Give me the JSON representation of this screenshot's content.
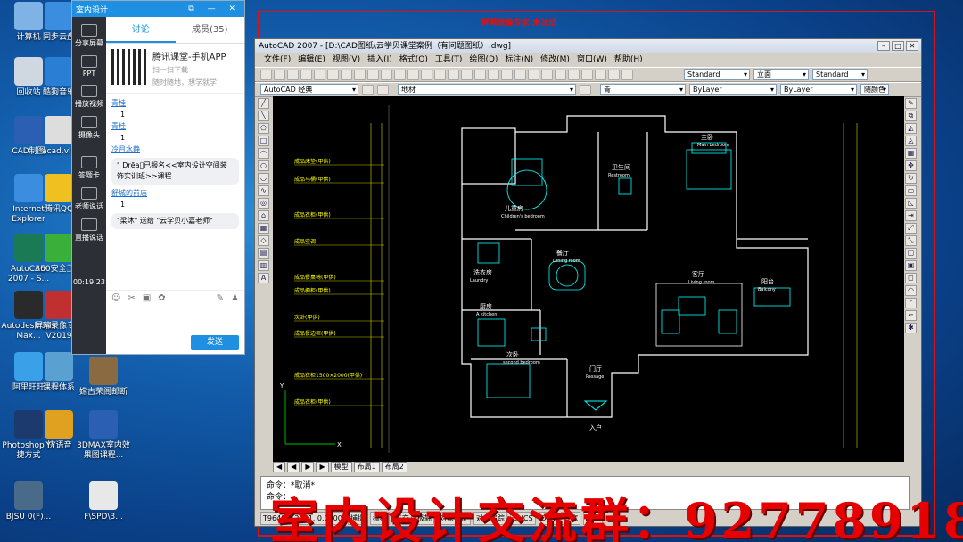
{
  "desktop_icons": [
    {
      "label": "计算机",
      "color": "#7fb3e6"
    },
    {
      "label": "回收站",
      "color": "#cfd8e0"
    },
    {
      "label": "CAD制图",
      "color": "#2b5fb4"
    },
    {
      "label": "Internet Explorer",
      "color": "#3b8de0"
    },
    {
      "label": "AutoCAD 2007 - S...",
      "color": "#1a7a55"
    },
    {
      "label": "Autodesk 3ds Max...",
      "color": "#2a2a2a"
    },
    {
      "label": "阿里旺旺",
      "color": "#3aa0e8"
    },
    {
      "label": "Photoshop 快捷方式",
      "color": "#1c3a6e"
    },
    {
      "label": "BJSU 0(F)...",
      "color": "#4a6a8a"
    },
    {
      "label": "同步云盘",
      "color": "#3b8de0"
    },
    {
      "label": "酷狗音乐",
      "color": "#2a7fd4"
    },
    {
      "label": "acad.vlx",
      "color": "#dddddd"
    },
    {
      "label": "腾讯QQ",
      "color": "#f0c020"
    },
    {
      "label": "360安全卫士",
      "color": "#3ab03a"
    },
    {
      "label": "屏幕录像专家 V2019",
      "color": "#c03030"
    },
    {
      "label": "课程体系",
      "color": "#5aa0d0"
    },
    {
      "label": "YY语音",
      "color": "#e0a020"
    },
    {
      "label": "F\\SPD\\3...",
      "color": "#e8e8e8"
    },
    {
      "label": "嫦古荣阁邮断",
      "color": "#8a6a40"
    },
    {
      "label": "3DMAX室内效果图课程...",
      "color": "#2b5fb4"
    }
  ],
  "qq_panel": {
    "title": "室内设计...",
    "side_items": [
      "分享屏幕",
      "PPT",
      "播放视频",
      "摄像头",
      "答题卡",
      "老师说话",
      "直播说话"
    ],
    "timer": "00:19:23",
    "tabs": [
      {
        "label": "讨论",
        "active": true
      },
      {
        "label": "成员(35)",
        "active": false
      }
    ],
    "promo": {
      "title": "腾讯课堂-手机APP",
      "line1": "扫一扫下载",
      "line2": "随时随地，想学就学"
    },
    "messages": [
      {
        "user": "青桂",
        "text": "1"
      },
      {
        "user": "青桂",
        "text": "1"
      },
      {
        "user": "冷月水静",
        "text": "\" Drēa゙已报名<<室内设计空间装饰实训班>>课程"
      },
      {
        "user": "舒城的前庙",
        "text": "1"
      },
      {
        "user": "",
        "text": "\"梁沐\" 送给 \"云学贝小嘉老师\""
      }
    ],
    "send_label": "发送"
  },
  "recorder": {
    "title": "屏幕录像专家  未注册"
  },
  "acad": {
    "title": "AutoCAD 2007 - [D:\\CAD图纸\\云学贝课堂案例（有问题图纸）.dwg]",
    "menu": [
      "文件(F)",
      "编辑(E)",
      "视图(V)",
      "插入(I)",
      "格式(O)",
      "工具(T)",
      "绘图(D)",
      "标注(N)",
      "修改(M)",
      "窗口(W)",
      "帮助(H)"
    ],
    "style_combo": "Standard",
    "dim_combo": "立面",
    "table_combo": "Standard",
    "workspace": "AutoCAD 经典",
    "layer": "地材",
    "color": "青",
    "linetype": "ByLayer",
    "lineweight": "ByLayer",
    "plotstyle": "随颜色",
    "layout_tabs": [
      "模型",
      "布局1",
      "布局2"
    ],
    "command_lines": [
      "命令：*取消*",
      "命令："
    ],
    "status_coords": "T9640, 12261, 0.0000",
    "status_toggles": [
      "捕捉",
      "栅格",
      "正交",
      "极轴",
      "对象捕捉",
      "对象追踪",
      "DUCS",
      "DYN",
      "线宽",
      "模型"
    ],
    "rooms": [
      {
        "name": "卫生间",
        "en": "Restroom"
      },
      {
        "name": "主卧",
        "en": "Main bedroom"
      },
      {
        "name": "儿童房",
        "en": "Children's bedroom"
      },
      {
        "name": "洗衣房",
        "en": "Laundry"
      },
      {
        "name": "餐厅",
        "en": "Dining room"
      },
      {
        "name": "客厅",
        "en": "Living room"
      },
      {
        "name": "阳台",
        "en": "Balcony"
      },
      {
        "name": "厨房",
        "en": "A kitchen"
      },
      {
        "name": "门厅",
        "en": "Passage"
      },
      {
        "name": "次卧",
        "en": "second bedroom"
      },
      {
        "name": "入户",
        "en": ""
      }
    ],
    "left_labels": [
      "成品床垫(甲供)",
      "成品马桶(甲供)",
      "成品衣柜(甲供)",
      "成品空调",
      "成品餐桌椅(甲供)",
      "成品橱柜(甲供)",
      "次卧(甲供)",
      "成品餐边柜(甲供)",
      "成品衣柜1500×2000(甲供)",
      "成品衣柜(甲供)"
    ]
  },
  "watermark": "室内设计交流群：92778918"
}
